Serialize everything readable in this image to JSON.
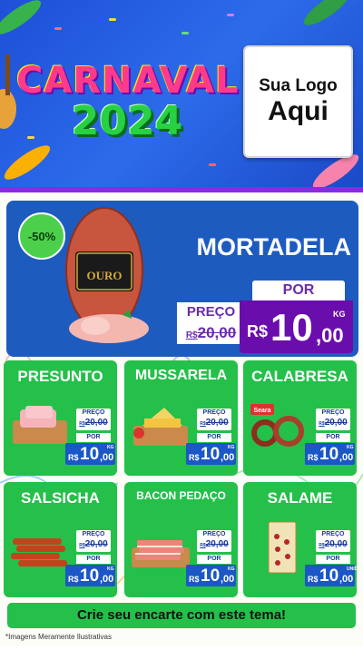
{
  "header": {
    "title_line1": "CARNAVAL",
    "title_line2": "2024",
    "logo_line1": "Sua Logo",
    "logo_line2": "Aqui"
  },
  "featured": {
    "discount": "-50%",
    "name": "MORTADELA",
    "brand_on_package": "OURO",
    "por_label": "POR",
    "preco_label": "PREÇO",
    "old_currency": "R$",
    "old_price": "20,00",
    "new_currency": "R$",
    "new_price_int": "10",
    "new_price_cents": ",00",
    "unit": "KG"
  },
  "products": [
    {
      "name": "PRESUNTO",
      "preco_label": "PREÇO",
      "old_currency": "R$",
      "old_price": "20,00",
      "por_label": "POR",
      "currency": "R$",
      "price_int": "10",
      "price_cents": ",00",
      "unit": "KG"
    },
    {
      "name": "MUSSARELA",
      "preco_label": "PREÇO",
      "old_currency": "R$",
      "old_price": "20,00",
      "por_label": "POR",
      "currency": "R$",
      "price_int": "10",
      "price_cents": ",00",
      "unit": "KG"
    },
    {
      "name": "CALABRESA",
      "preco_label": "PREÇO",
      "old_currency": "R$",
      "old_price": "20,00",
      "por_label": "POR",
      "currency": "R$",
      "price_int": "10",
      "price_cents": ",00",
      "unit": "KG",
      "brand_on_package": "Seara"
    },
    {
      "name": "SALSICHA",
      "preco_label": "PREÇO",
      "old_currency": "R$",
      "old_price": "20,00",
      "por_label": "POR",
      "currency": "R$",
      "price_int": "10",
      "price_cents": ",00",
      "unit": "KG"
    },
    {
      "name": "BACON PEDAÇO",
      "preco_label": "PREÇO",
      "old_currency": "R$",
      "old_price": "20,00",
      "por_label": "POR",
      "currency": "R$",
      "price_int": "10",
      "price_cents": ",00",
      "unit": "KG"
    },
    {
      "name": "SALAME",
      "preco_label": "PREÇO",
      "old_currency": "R$",
      "old_price": "20,00",
      "por_label": "POR",
      "currency": "R$",
      "price_int": "10",
      "price_cents": ",00",
      "unit": "UNID"
    }
  ],
  "footer": {
    "cta": "Crie seu encarte com este tema!",
    "note": "*Imagens Meramente Ilustrativas"
  },
  "colors": {
    "header_blue": "#1e4fd8",
    "featured_blue": "#1e5bbf",
    "card_green": "#24c04a",
    "price_purple": "#6a0dad",
    "price_blue": "#1b57c6"
  }
}
